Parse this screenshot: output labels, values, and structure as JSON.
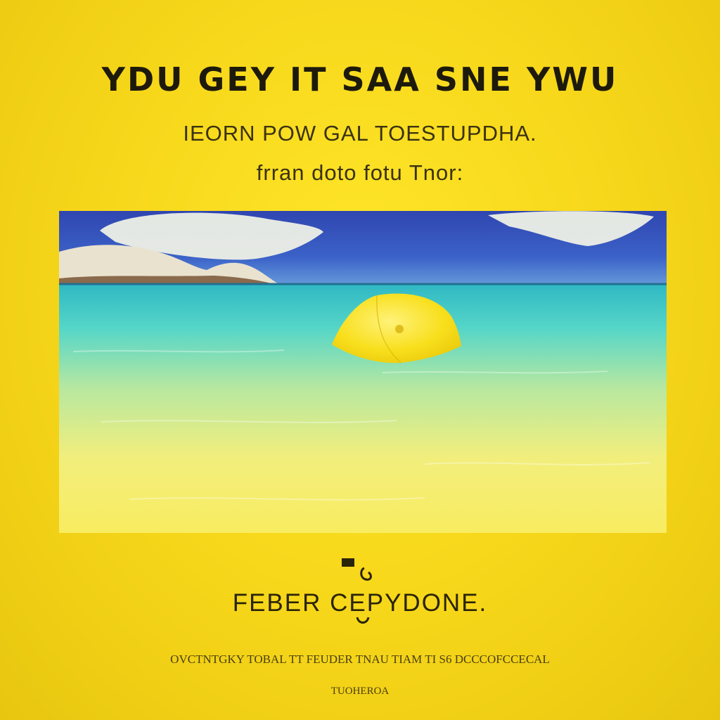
{
  "poster": {
    "headline": "YDU GEY IT SAA SNE YWU",
    "subline_1": "IEORN POW GAL TOESTUPDHA.",
    "subline_2": "frran doto fotu Tnor:",
    "footer_title": "FEBER CEPYDONE.",
    "fine_print": "OVCTNTGKY TOBAL TT FEUDER TNAU TIAM TI S6 DCCCOFCCECAL",
    "fine_print_2": "TUOHEROA"
  },
  "colors": {
    "background": "#f6d619",
    "text": "#1d1a0c",
    "sky": "#3a4fb8",
    "sea": "#5fd6c6",
    "umbrella": "#f5dc18"
  }
}
